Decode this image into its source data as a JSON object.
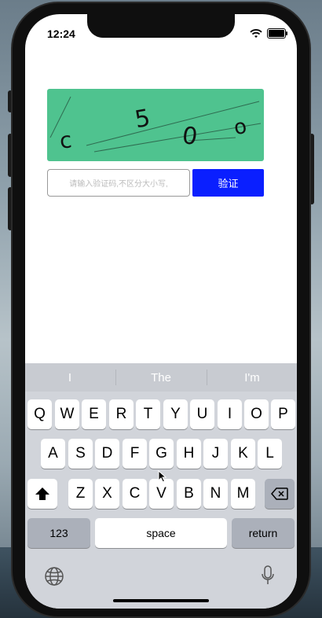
{
  "status": {
    "time": "12:24"
  },
  "captcha": {
    "chars": [
      "c",
      "5",
      "0",
      "o"
    ]
  },
  "form": {
    "input_placeholder": "请输入验证码,不区分大小写,",
    "verify_label": "验证"
  },
  "keyboard": {
    "predictions": [
      "I",
      "The",
      "I'm"
    ],
    "row1": [
      "Q",
      "W",
      "E",
      "R",
      "T",
      "Y",
      "U",
      "I",
      "O",
      "P"
    ],
    "row2": [
      "A",
      "S",
      "D",
      "F",
      "G",
      "H",
      "J",
      "K",
      "L"
    ],
    "row3": [
      "Z",
      "X",
      "C",
      "V",
      "B",
      "N",
      "M"
    ],
    "numbers_label": "123",
    "space_label": "space",
    "return_label": "return"
  },
  "icons": [
    "wifi-icon",
    "battery-icon",
    "shift-icon",
    "backspace-icon",
    "globe-icon",
    "microphone-icon",
    "mouse-cursor-icon"
  ]
}
